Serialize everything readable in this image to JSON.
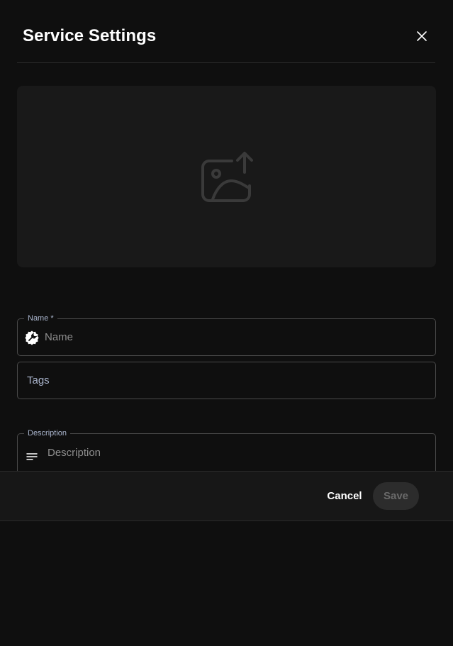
{
  "dialog": {
    "title": "Service Settings",
    "close_icon": "close-icon"
  },
  "image_upload": {
    "icon": "image-upload-icon"
  },
  "form": {
    "name": {
      "label": "Name *",
      "placeholder": "Name",
      "icon": "service-icon"
    },
    "tags": {
      "placeholder": "Tags"
    },
    "description": {
      "label": "Description",
      "placeholder": "Description",
      "icon": "text-lines-icon"
    }
  },
  "footer": {
    "cancel_label": "Cancel",
    "save_label": "Save"
  },
  "colors": {
    "background": "#0f0f0f",
    "panel": "#191919",
    "footer": "#171717",
    "border": "#4a4a4a",
    "label": "#a9b4cc",
    "save_bg": "#2c2c2c"
  }
}
